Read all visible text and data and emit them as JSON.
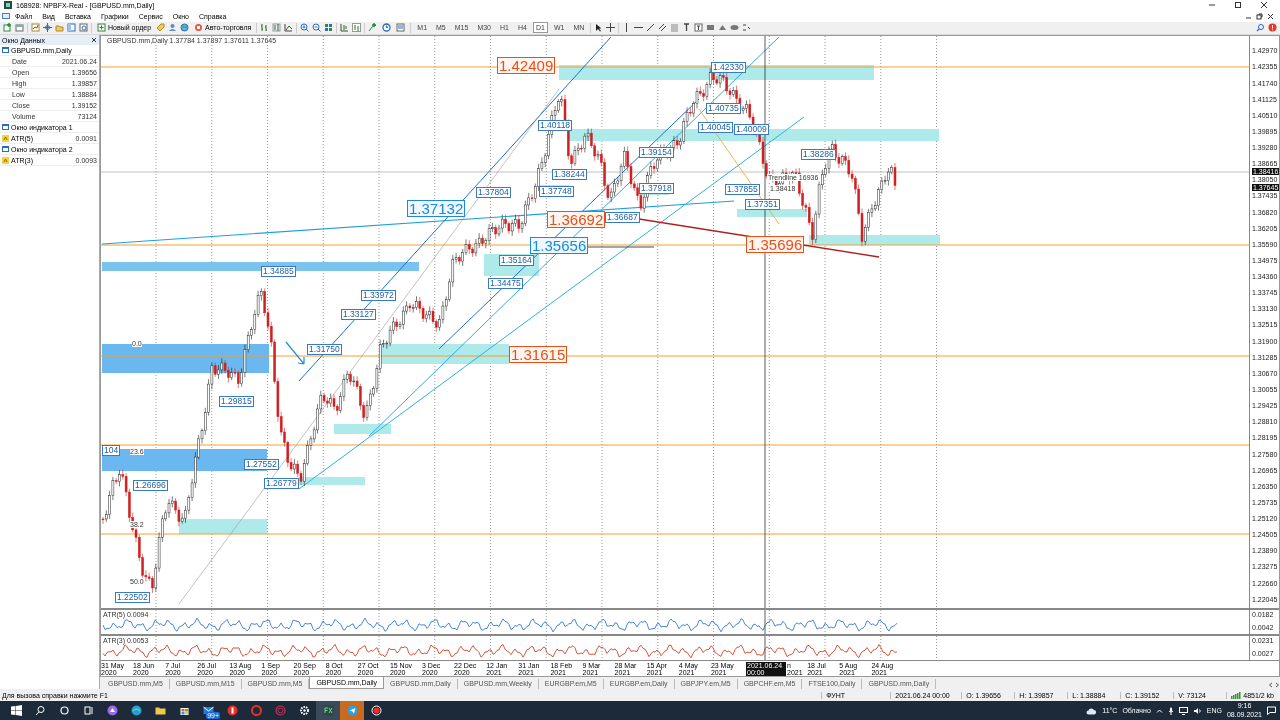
{
  "window": {
    "title": "168928: NPBFX-Real - [GBPUSD.mm,Daily]"
  },
  "menu": [
    "Файл",
    "Вид",
    "Вставка",
    "Графики",
    "Сервис",
    "Окно",
    "Справка"
  ],
  "toolbar": {
    "new_order": "Новый ордер",
    "auto_trading": "Авто-торговля",
    "timeframes": [
      {
        "label": "M1",
        "selected": false
      },
      {
        "label": "M5",
        "selected": false
      },
      {
        "label": "M15",
        "selected": false
      },
      {
        "label": "M30",
        "selected": false
      },
      {
        "label": "H1",
        "selected": false
      },
      {
        "label": "H4",
        "selected": false
      },
      {
        "label": "D1",
        "selected": true
      },
      {
        "label": "W1",
        "selected": false
      },
      {
        "label": "MN",
        "selected": false
      }
    ]
  },
  "data_window": {
    "title": "Окно Данных",
    "symbol": "GBPUSD.mm,Daily",
    "rows": [
      {
        "name": "Date",
        "value": "2021.06.24"
      },
      {
        "name": "Open",
        "value": "1.39656"
      },
      {
        "name": "High",
        "value": "1.39857"
      },
      {
        "name": "Low",
        "value": "1.38884"
      },
      {
        "name": "Close",
        "value": "1.39152"
      },
      {
        "name": "Volume",
        "value": "73124"
      }
    ],
    "indicators": [
      {
        "window": "Окно индикатора 1",
        "name": "ATR(5)",
        "value": "0.0091"
      },
      {
        "window": "Окно индикатора 2",
        "name": "ATR(3)",
        "value": "0.0093"
      }
    ]
  },
  "chart": {
    "header": "GBPUSD.mm,Daily 1.37784 1.37897 1.37611 1.37645",
    "price_axis": [
      "1.42970",
      "1.42355",
      "1.41740",
      "1.41125",
      "1.40510",
      "1.39895",
      "1.39280",
      "1.38665",
      "1.38050",
      "1.37435",
      "1.36820",
      "1.36205",
      "1.35590",
      "1.34975",
      "1.34360",
      "1.33745",
      "1.33130",
      "1.32515",
      "1.31900",
      "1.31285",
      "1.30670",
      "1.30055",
      "1.29425",
      "1.28810",
      "1.28195",
      "1.27580",
      "1.26965",
      "1.26350",
      "1.25735",
      "1.25120",
      "1.24505",
      "1.23890",
      "1.23275",
      "1.22660",
      "1.22045"
    ],
    "price_markers": [
      "1.38416",
      "1.37645"
    ],
    "annotations": [
      {
        "text": "1.42409",
        "kind": "red"
      },
      {
        "text": "1.42330",
        "kind": "small"
      },
      {
        "text": "1.40735",
        "kind": "small"
      },
      {
        "text": "1.40118",
        "kind": "small"
      },
      {
        "text": "1.40045",
        "kind": "small"
      },
      {
        "text": "1.40009",
        "kind": "small"
      },
      {
        "text": "1.39154",
        "kind": "small"
      },
      {
        "text": "1.38286",
        "kind": "small"
      },
      {
        "text": "1.38244",
        "kind": "small"
      },
      {
        "text": "Trendline 16936",
        "kind": "plain"
      },
      {
        "text": "1.37804",
        "kind": "small"
      },
      {
        "text": "1.37748",
        "kind": "small"
      },
      {
        "text": "1.37918",
        "kind": "small"
      },
      {
        "text": "1.37855",
        "kind": "small"
      },
      {
        "text": "1.38418",
        "kind": "plain"
      },
      {
        "text": "1.37132",
        "kind": "blue"
      },
      {
        "text": "1.36692",
        "kind": "red"
      },
      {
        "text": "1.36687",
        "kind": "small"
      },
      {
        "text": "1.37351",
        "kind": "small"
      },
      {
        "text": "1.35656",
        "kind": "blue"
      },
      {
        "text": "1.35696",
        "kind": "red"
      },
      {
        "text": "1.35164",
        "kind": "small"
      },
      {
        "text": "1.34885",
        "kind": "small"
      },
      {
        "text": "1.34475",
        "kind": "small"
      },
      {
        "text": "1.33972",
        "kind": "small"
      },
      {
        "text": "1.33127",
        "kind": "small"
      },
      {
        "text": "0.0",
        "kind": "fib"
      },
      {
        "text": "1.31750",
        "kind": "small"
      },
      {
        "text": "1.31615",
        "kind": "red"
      },
      {
        "text": "1.29815",
        "kind": "small"
      },
      {
        "text": "104",
        "kind": "small"
      },
      {
        "text": "23.6",
        "kind": "fib"
      },
      {
        "text": "1.27552",
        "kind": "small"
      },
      {
        "text": "1.26696",
        "kind": "small"
      },
      {
        "text": "1.26779",
        "kind": "small"
      },
      {
        "text": "38.2",
        "kind": "fib"
      },
      {
        "text": "50.0",
        "kind": "fib"
      },
      {
        "text": "1.22502",
        "kind": "small"
      }
    ]
  },
  "indicators": [
    {
      "header": "ATR(5) 0.0094",
      "axis": [
        "0.0182",
        "0.0042"
      ]
    },
    {
      "header": "ATR(3) 0.0053",
      "axis": [
        "0.0231",
        "0.0027"
      ]
    }
  ],
  "time_axis": {
    "ticks": [
      {
        "label": "31 May 2020",
        "kind": "tick"
      },
      {
        "label": "18 Jun 2020",
        "kind": "tick"
      },
      {
        "label": "7 Jul 2020",
        "kind": "tick"
      },
      {
        "label": "26 Jul 2020",
        "kind": "tick"
      },
      {
        "label": "13 Aug 2020",
        "kind": "tick"
      },
      {
        "label": "1 Sep 2020",
        "kind": "tick"
      },
      {
        "label": "20 Sep 2020",
        "kind": "tick"
      },
      {
        "label": "8 Oct 2020",
        "kind": "tick"
      },
      {
        "label": "27 Oct 2020",
        "kind": "tick"
      },
      {
        "label": "15 Nov 2020",
        "kind": "tick"
      },
      {
        "label": "3 Dec 2020",
        "kind": "tick"
      },
      {
        "label": "22 Dec 2020",
        "kind": "tick"
      },
      {
        "label": "12 Jan 2021",
        "kind": "tick"
      },
      {
        "label": "31 Jan 2021",
        "kind": "tick"
      },
      {
        "label": "18 Feb 2021",
        "kind": "tick"
      },
      {
        "label": "9 Mar 2021",
        "kind": "tick"
      },
      {
        "label": "28 Mar 2021",
        "kind": "tick"
      },
      {
        "label": "15 Apr 2021",
        "kind": "tick"
      },
      {
        "label": "4 May 2021",
        "kind": "tick"
      },
      {
        "label": "23 May 2021",
        "kind": "tick"
      },
      {
        "label": "n 2021",
        "kind": "partial"
      },
      {
        "label": "18 Jul 2021",
        "kind": "tick"
      },
      {
        "label": "5 Aug 2021",
        "kind": "tick"
      },
      {
        "label": "24 Aug 2021",
        "kind": "tick"
      }
    ],
    "cursor": "2021.06.24 00:00"
  },
  "tabs": [
    {
      "label": "GBPUSD.mm,M5",
      "selected": false
    },
    {
      "label": "GBPUSD.mm,M15",
      "selected": false
    },
    {
      "label": "GBPUSD.mm,M5",
      "selected": false
    },
    {
      "label": "GBPUSD.mm,Daily",
      "selected": true
    },
    {
      "label": "GBPUSD.mm,Daily",
      "selected": false
    },
    {
      "label": "GBPUSD.mm,Weekly",
      "selected": false
    },
    {
      "label": "EURGBP.em,M5",
      "selected": false
    },
    {
      "label": "EURGBP.em,Daily",
      "selected": false
    },
    {
      "label": "GBPJPY.em,M5",
      "selected": false
    },
    {
      "label": "GBPCHF.em,M5",
      "selected": false
    },
    {
      "label": "FTSE100,Daily",
      "selected": false
    },
    {
      "label": "GBPUSD.mm,Daily",
      "selected": false
    }
  ],
  "status_bar": {
    "help": "Для вызова справки нажмите F1",
    "profile": "ФУНТ",
    "time": "2021.06.24 00:00",
    "open": "O: 1.39656",
    "high": "H: 1.39857",
    "low": "L: 1.38884",
    "close": "C: 1.39152",
    "volume": "V: 73124",
    "traffic": "4851/2 kb"
  },
  "taskbar": {
    "badge": "99+",
    "temperature": "11°C",
    "weather": "Облачно",
    "language": "ENG",
    "time": "9:16",
    "date": "08.09.2021"
  }
}
